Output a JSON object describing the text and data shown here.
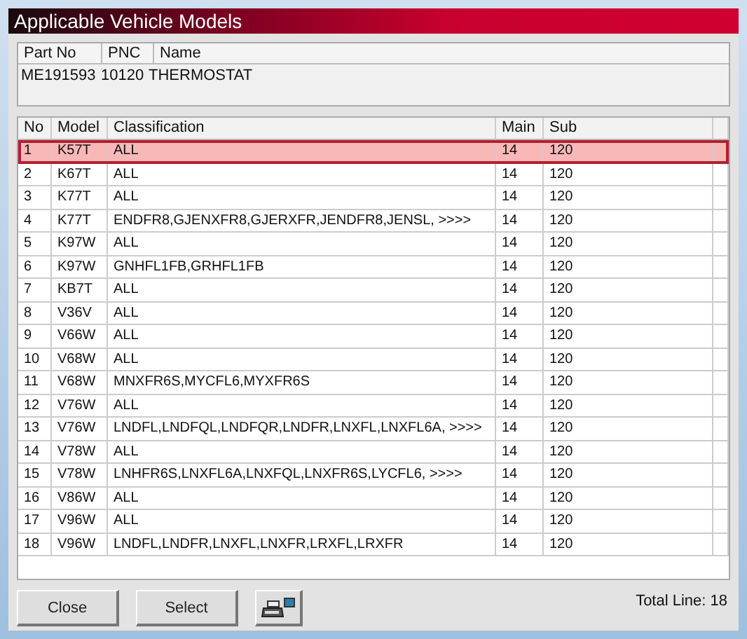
{
  "window": {
    "title": "Applicable Vehicle Models"
  },
  "part": {
    "columns": [
      "Part No",
      "PNC",
      "Name"
    ],
    "values": [
      "ME191593",
      "10120",
      "THERMOSTAT"
    ]
  },
  "table": {
    "columns": [
      "No",
      "Model",
      "Classification",
      "Main",
      "Sub"
    ],
    "rows": [
      {
        "cells": [
          "1",
          "K57T",
          "ALL",
          "14",
          "120"
        ],
        "selected": true
      },
      {
        "cells": [
          "2",
          "K67T",
          "ALL",
          "14",
          "120"
        ],
        "selected": false
      },
      {
        "cells": [
          "3",
          "K77T",
          "ALL",
          "14",
          "120"
        ],
        "selected": false
      },
      {
        "cells": [
          "4",
          "K77T",
          "ENDFR8,GJENXFR8,GJERXFR,JENDFR8,JENSL,  >>>>",
          "14",
          "120"
        ],
        "selected": false
      },
      {
        "cells": [
          "5",
          "K97W",
          "ALL",
          "14",
          "120"
        ],
        "selected": false
      },
      {
        "cells": [
          "6",
          "K97W",
          "GNHFL1FB,GRHFL1FB",
          "14",
          "120"
        ],
        "selected": false
      },
      {
        "cells": [
          "7",
          "KB7T",
          "ALL",
          "14",
          "120"
        ],
        "selected": false
      },
      {
        "cells": [
          "8",
          "V36V",
          "ALL",
          "14",
          "120"
        ],
        "selected": false
      },
      {
        "cells": [
          "9",
          "V66W",
          "ALL",
          "14",
          "120"
        ],
        "selected": false
      },
      {
        "cells": [
          "10",
          "V68W",
          "ALL",
          "14",
          "120"
        ],
        "selected": false
      },
      {
        "cells": [
          "11",
          "V68W",
          "MNXFR6S,MYCFL6,MYXFR6S",
          "14",
          "120"
        ],
        "selected": false
      },
      {
        "cells": [
          "12",
          "V76W",
          "ALL",
          "14",
          "120"
        ],
        "selected": false
      },
      {
        "cells": [
          "13",
          "V76W",
          "LNDFL,LNDFQL,LNDFQR,LNDFR,LNXFL,LNXFL6A,  >>>>",
          "14",
          "120"
        ],
        "selected": false
      },
      {
        "cells": [
          "14",
          "V78W",
          "ALL",
          "14",
          "120"
        ],
        "selected": false
      },
      {
        "cells": [
          "15",
          "V78W",
          "LNHFR6S,LNXFL6A,LNXFQL,LNXFR6S,LYCFL6,  >>>>",
          "14",
          "120"
        ],
        "selected": false
      },
      {
        "cells": [
          "16",
          "V86W",
          "ALL",
          "14",
          "120"
        ],
        "selected": false
      },
      {
        "cells": [
          "17",
          "V96W",
          "ALL",
          "14",
          "120"
        ],
        "selected": false
      },
      {
        "cells": [
          "18",
          "V96W",
          "LNDFL,LNDFR,LNXFL,LNXFR,LRXFL,LRXFR",
          "14",
          "120"
        ],
        "selected": false
      }
    ]
  },
  "buttons": [
    "Close",
    "Select"
  ],
  "status": "Total Line: 18"
}
